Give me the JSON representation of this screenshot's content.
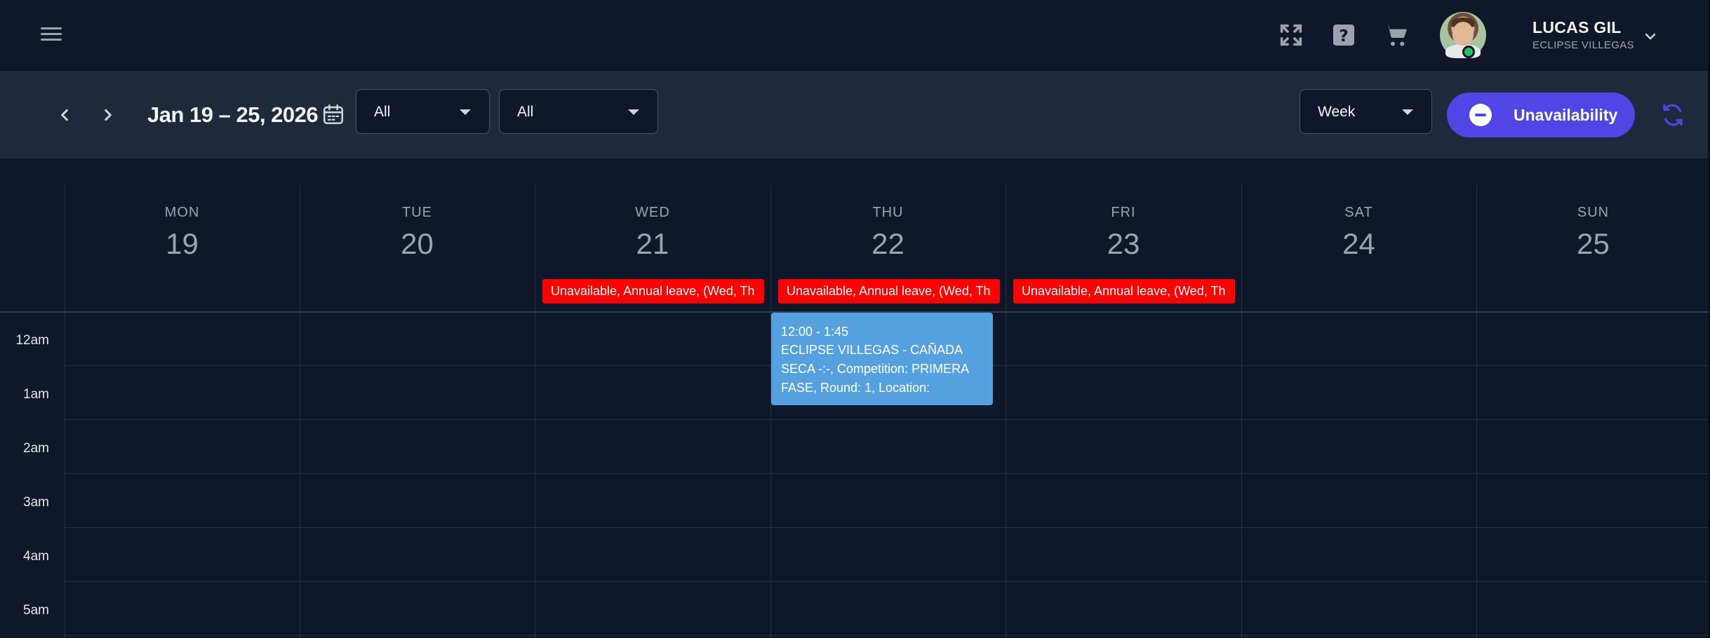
{
  "header": {
    "user_name": "LUCAS GIL",
    "user_org": "ECLIPSE VILLEGAS",
    "icons": [
      "menu-icon",
      "fullscreen-icon",
      "help-icon",
      "cart-icon",
      "chevron-down-icon"
    ]
  },
  "toolbar": {
    "date_range": "Jan 19 – 25, 2026",
    "filter_1": "All",
    "filter_2": "All",
    "view": "Week",
    "unavailability_label": "Unavailability"
  },
  "calendar": {
    "days": [
      {
        "name": "MON",
        "num": "19"
      },
      {
        "name": "TUE",
        "num": "20"
      },
      {
        "name": "WED",
        "num": "21"
      },
      {
        "name": "THU",
        "num": "22"
      },
      {
        "name": "FRI",
        "num": "23"
      },
      {
        "name": "SAT",
        "num": "24"
      },
      {
        "name": "SUN",
        "num": "25"
      }
    ],
    "all_day_events": [
      {
        "day": "WED",
        "text": "Unavailable, Annual leave, (Wed, Th"
      },
      {
        "day": "THU",
        "text": "Unavailable, Annual leave, (Wed, Th"
      },
      {
        "day": "FRI",
        "text": "Unavailable, Annual leave, (Wed, Th"
      }
    ],
    "times": [
      "12am",
      "1am",
      "2am",
      "3am",
      "4am",
      "5am"
    ],
    "event": {
      "time": "12:00 - 1:45",
      "description": "ECLIPSE VILLEGAS - CAÑADA SECA -:-, Competition: PRIMERA FASE, Round: 1, Location:"
    }
  },
  "colors": {
    "background": "#0f172a",
    "toolbar": "#1e293b",
    "accent": "#4f46e5",
    "unavailable": "#ff0000",
    "event": "#55a1e0",
    "online": "#22c55e"
  }
}
